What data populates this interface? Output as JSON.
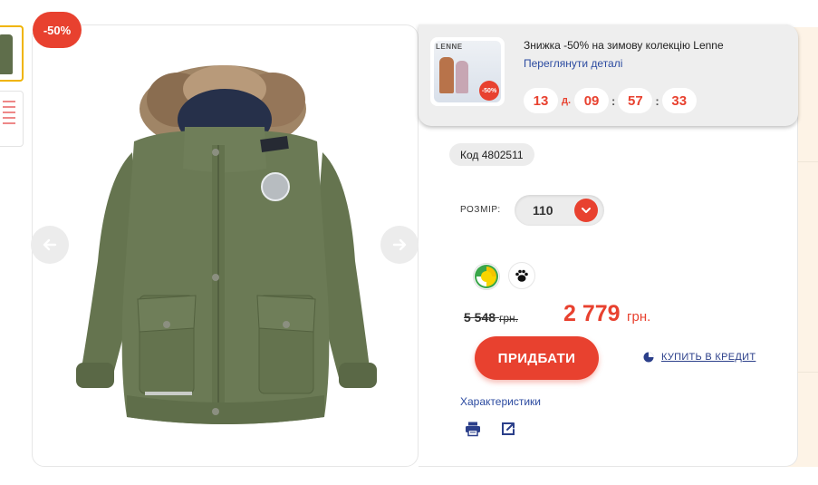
{
  "product": {
    "discount_badge": "-50%",
    "code": "Код 4802511"
  },
  "promo": {
    "title": "Знижка -50% на зимову колекцію Lenne",
    "link": "Переглянути деталі",
    "thumb_logo": "LENNE",
    "thumb_badge": "-50%",
    "timer": {
      "days": "13",
      "days_unit": "д.",
      "hours": "09",
      "minutes": "57",
      "seconds": "33",
      "separator": ":"
    }
  },
  "size": {
    "label": "РОЗМІР:",
    "value": "110"
  },
  "price": {
    "old": "5 548",
    "old_currency": "грн.",
    "new": "2 779",
    "new_currency": "грн."
  },
  "actions": {
    "buy": "ПРИДБАТИ",
    "credit": "КУПИТЬ В КРЕДИТ",
    "characteristics": "Характеристики"
  },
  "icons": {
    "prev": "arrow-left-icon",
    "next": "arrow-right-icon",
    "season": "season-icon",
    "paw": "paw-icon",
    "print": "printer-icon",
    "share": "share-icon",
    "credit": "pie-chart-icon",
    "caret": "chevron-down-icon"
  },
  "colors": {
    "accent": "#e8412f",
    "link": "#2b4aa0",
    "jacket": "#5f6e4b"
  }
}
